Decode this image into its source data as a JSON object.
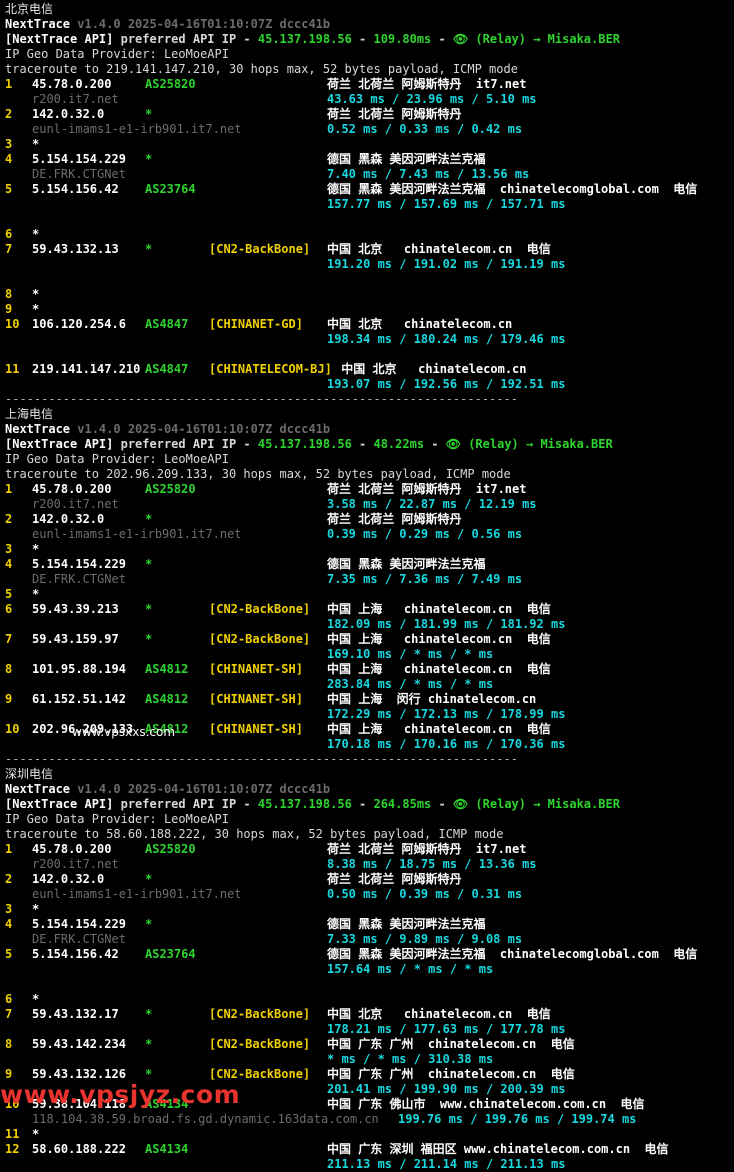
{
  "sections": [
    {
      "title": "北京电信",
      "app_name": "NextTrace",
      "version_line": " v1.4.0 2025-04-16T01:10:07Z dccc41b",
      "api_prefix": "[NextTrace API]",
      "api_mid": " preferred API IP - ",
      "api_ip": "45.137.198.56",
      "api_sep": " - ",
      "api_latency": "109.80ms",
      "api_tail": " - ",
      "relay": "👁 (Relay) → Misaka.BER",
      "provider": "IP Geo Data Provider: LeoMoeAPI",
      "traceroute": "traceroute to 219.141.147.210, 30 hops max, 52 bytes payload, ICMP mode",
      "hops": [
        {
          "n": "1",
          "ip": "45.78.0.200",
          "as": "AS25820",
          "tag": "",
          "loc": "荷兰 北荷兰 阿姆斯特丹  it7.net",
          "rdns": "r200.it7.net",
          "rtt": "43.63 ms / 23.96 ms / 5.10 ms"
        },
        {
          "n": "2",
          "ip": "142.0.32.0",
          "as": "*",
          "tag": "",
          "loc": "荷兰 北荷兰 阿姆斯特丹",
          "rdns": "eunl-imams1-e1-irb901.it7.net",
          "rtt": "0.52 ms / 0.33 ms / 0.42 ms"
        },
        {
          "n": "3",
          "ip": "*",
          "as": "",
          "tag": "",
          "loc": "",
          "rdns": "",
          "rtt": ""
        },
        {
          "n": "4",
          "ip": "5.154.154.229",
          "as": "*",
          "tag": "",
          "loc": "德国 黑森 美因河畔法兰克福",
          "rdns": "DE.FRK.CTGNet",
          "rtt": "7.40 ms / 7.43 ms / 13.56 ms"
        },
        {
          "n": "5",
          "ip": "5.154.156.42",
          "as": "AS23764",
          "tag": "",
          "loc": "德国 黑森 美因河畔法兰克福  chinatelecomglobal.com  电信",
          "rdns": "",
          "rtt": "157.77 ms / 157.69 ms / 157.71 ms"
        },
        {
          "n": "6",
          "ip": "*",
          "as": "",
          "tag": "",
          "loc": "",
          "rdns": "",
          "rtt": ""
        },
        {
          "n": "7",
          "ip": "59.43.132.13",
          "as": "*",
          "tag": "[CN2-BackBone]",
          "loc": "中国 北京   chinatelecom.cn  电信",
          "rdns": "",
          "rtt": "191.20 ms / 191.02 ms / 191.19 ms"
        },
        {
          "n": "8",
          "ip": "*",
          "as": "",
          "tag": "",
          "loc": "",
          "rdns": "",
          "rtt": ""
        },
        {
          "n": "9",
          "ip": "*",
          "as": "",
          "tag": "",
          "loc": "",
          "rdns": "",
          "rtt": ""
        },
        {
          "n": "10",
          "ip": "106.120.254.6",
          "as": "AS4847",
          "tag": "[CHINANET-GD]",
          "loc": "中国 北京   chinatelecom.cn",
          "rdns": "",
          "rtt": "198.34 ms / 180.24 ms / 179.46 ms"
        },
        {
          "n": "11",
          "ip": "219.141.147.210",
          "as": "AS4847",
          "tag": "[CHINATELECOM-BJ]",
          "loc": " 中国 北京   chinatelecom.cn",
          "rdns": "",
          "rtt": "193.07 ms / 192.56 ms / 192.51 ms"
        }
      ]
    },
    {
      "title": "上海电信",
      "app_name": "NextTrace",
      "version_line": " v1.4.0 2025-04-16T01:10:07Z dccc41b",
      "api_prefix": "[NextTrace API]",
      "api_mid": " preferred API IP - ",
      "api_ip": "45.137.198.56",
      "api_sep": " - ",
      "api_latency": "48.22ms",
      "api_tail": " - ",
      "relay": "👁 (Relay) → Misaka.BER",
      "provider": "IP Geo Data Provider: LeoMoeAPI",
      "traceroute": "traceroute to 202.96.209.133, 30 hops max, 52 bytes payload, ICMP mode",
      "hops": [
        {
          "n": "1",
          "ip": "45.78.0.200",
          "as": "AS25820",
          "tag": "",
          "loc": "荷兰 北荷兰 阿姆斯特丹  it7.net",
          "rdns": "r200.it7.net",
          "rtt": "3.58 ms / 22.87 ms / 12.19 ms"
        },
        {
          "n": "2",
          "ip": "142.0.32.0",
          "as": "*",
          "tag": "",
          "loc": "荷兰 北荷兰 阿姆斯特丹",
          "rdns": "eunl-imams1-e1-irb901.it7.net",
          "rtt": "0.39 ms / 0.29 ms / 0.56 ms"
        },
        {
          "n": "3",
          "ip": "*",
          "as": "",
          "tag": "",
          "loc": "",
          "rdns": "",
          "rtt": ""
        },
        {
          "n": "4",
          "ip": "5.154.154.229",
          "as": "*",
          "tag": "",
          "loc": "德国 黑森 美因河畔法兰克福",
          "rdns": "DE.FRK.CTGNet",
          "rtt": "7.35 ms / 7.36 ms / 7.49 ms"
        },
        {
          "n": "5",
          "ip": "*",
          "as": "",
          "tag": "",
          "loc": "",
          "rdns": "",
          "rtt": ""
        },
        {
          "n": "6",
          "ip": "59.43.39.213",
          "as": "*",
          "tag": "[CN2-BackBone]",
          "loc": "中国 上海   chinatelecom.cn  电信",
          "rdns": "",
          "rtt": "182.09 ms / 181.99 ms / 181.92 ms"
        },
        {
          "n": "7",
          "ip": "59.43.159.97",
          "as": "*",
          "tag": "[CN2-BackBone]",
          "loc": "中国 上海   chinatelecom.cn  电信",
          "rdns": "",
          "rtt": "169.10 ms / * ms / * ms"
        },
        {
          "n": "8",
          "ip": "101.95.88.194",
          "as": "AS4812",
          "tag": "[CHINANET-SH]",
          "loc": "中国 上海   chinatelecom.cn  电信",
          "rdns": "",
          "rtt": "283.84 ms / * ms / * ms"
        },
        {
          "n": "9",
          "ip": "61.152.51.142",
          "as": "AS4812",
          "tag": "[CHINANET-SH]",
          "loc": "中国 上海  闵行 chinatelecom.cn",
          "rdns": "",
          "rtt": "172.29 ms / 172.13 ms / 178.99 ms"
        },
        {
          "n": "10",
          "ip": "202.96.209.133",
          "as": "AS4812",
          "tag": "[CHINANET-SH]",
          "loc": "中国 上海   chinatelecom.cn  电信",
          "rdns": "",
          "rtt": "170.18 ms / 170.16 ms / 170.36 ms"
        }
      ]
    },
    {
      "title": "深圳电信",
      "app_name": "NextTrace",
      "version_line": " v1.4.0 2025-04-16T01:10:07Z dccc41b",
      "api_prefix": "[NextTrace API]",
      "api_mid": " preferred API IP - ",
      "api_ip": "45.137.198.56",
      "api_sep": " - ",
      "api_latency": "264.85ms",
      "api_tail": " - ",
      "relay": "👁 (Relay) → Misaka.BER",
      "provider": "IP Geo Data Provider: LeoMoeAPI",
      "traceroute": "traceroute to 58.60.188.222, 30 hops max, 52 bytes payload, ICMP mode",
      "hops": [
        {
          "n": "1",
          "ip": "45.78.0.200",
          "as": "AS25820",
          "tag": "",
          "loc": "荷兰 北荷兰 阿姆斯特丹  it7.net",
          "rdns": "r200.it7.net",
          "rtt": "8.38 ms / 18.75 ms / 13.36 ms"
        },
        {
          "n": "2",
          "ip": "142.0.32.0",
          "as": "*",
          "tag": "",
          "loc": "荷兰 北荷兰 阿姆斯特丹",
          "rdns": "eunl-imams1-e1-irb901.it7.net",
          "rtt": "0.50 ms / 0.39 ms / 0.31 ms"
        },
        {
          "n": "3",
          "ip": "*",
          "as": "",
          "tag": "",
          "loc": "",
          "rdns": "",
          "rtt": ""
        },
        {
          "n": "4",
          "ip": "5.154.154.229",
          "as": "*",
          "tag": "",
          "loc": "德国 黑森 美因河畔法兰克福",
          "rdns": "DE.FRK.CTGNet",
          "rtt": "7.33 ms / 9.89 ms / 9.08 ms"
        },
        {
          "n": "5",
          "ip": "5.154.156.42",
          "as": "AS23764",
          "tag": "",
          "loc": "德国 黑森 美因河畔法兰克福  chinatelecomglobal.com  电信",
          "rdns": "",
          "rtt": "157.64 ms / * ms / * ms"
        },
        {
          "n": "6",
          "ip": "*",
          "as": "",
          "tag": "",
          "loc": "",
          "rdns": "",
          "rtt": ""
        },
        {
          "n": "7",
          "ip": "59.43.132.17",
          "as": "*",
          "tag": "[CN2-BackBone]",
          "loc": "中国 北京   chinatelecom.cn  电信",
          "rdns": "",
          "rtt": "178.21 ms / 177.63 ms / 177.78 ms"
        },
        {
          "n": "8",
          "ip": "59.43.142.234",
          "as": "*",
          "tag": "[CN2-BackBone]",
          "loc": "中国 广东 广州  chinatelecom.cn  电信",
          "rdns": "",
          "rtt": "* ms / * ms / 310.38 ms"
        },
        {
          "n": "9",
          "ip": "59.43.132.126",
          "as": "*",
          "tag": "[CN2-BackBone]",
          "loc": "中国 广东 广州  chinatelecom.cn  电信",
          "rdns": "",
          "rtt": "201.41 ms / 199.90 ms / 200.39 ms"
        },
        {
          "n": "10",
          "ip": "59.38.104.118",
          "as": "AS4134",
          "tag": "",
          "loc": "中国 广东 佛山市  www.chinatelecom.com.cn  电信",
          "rdns": "118.104.38.59.broad.fs.gd.dynamic.163data.com.cn",
          "rtt": "199.76 ms / 199.76 ms / 199.74 ms"
        },
        {
          "n": "11",
          "ip": "*",
          "as": "",
          "tag": "",
          "loc": "",
          "rdns": "",
          "rtt": ""
        },
        {
          "n": "12",
          "ip": "58.60.188.222",
          "as": "AS4134",
          "tag": "",
          "loc": "中国 广东 深圳 福田区 www.chinatelecom.com.cn  电信",
          "rdns": "",
          "rtt": "211.13 ms / 211.14 ms / 211.13 ms"
        }
      ]
    }
  ],
  "separator": "-----------------------------------------------------------------------",
  "watermark_top": "www.vpsxxs.com",
  "watermark_bottom": "www.vpsjyz.com",
  "colors": {
    "background": "#000000",
    "hop_number": "#f0d000",
    "asn": "#2ed42e",
    "tag": "#f0d000",
    "rtt": "#18d8e0",
    "rdns": "#6c6c6c",
    "watermark": "#e8332e"
  }
}
